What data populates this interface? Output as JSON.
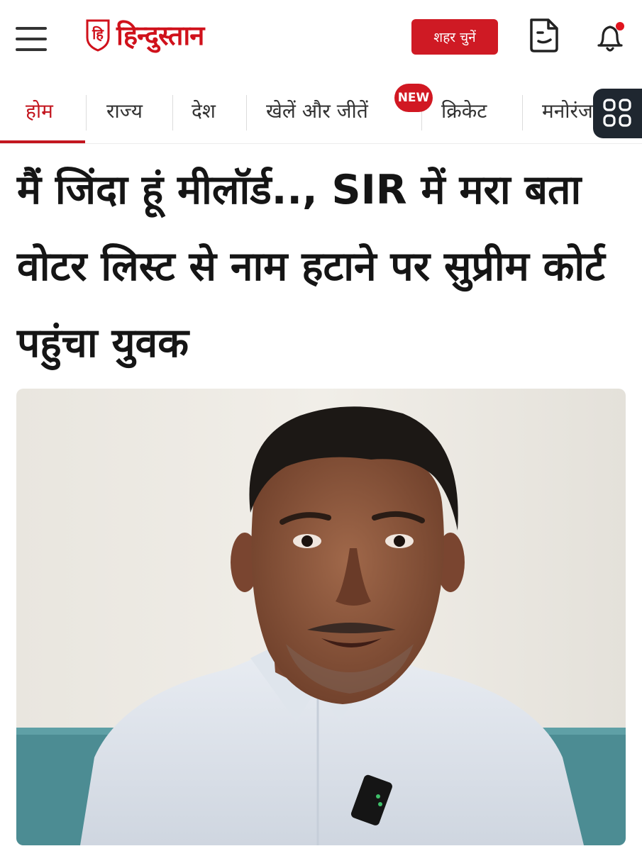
{
  "header": {
    "logo_mark": "हि",
    "logo_text": "हिन्दुस्तान",
    "city_button": "शहर चुनें",
    "accent_color": "#cf1a24",
    "icons": [
      "hamburger-menu-icon",
      "epaper-icon",
      "bell-icon",
      "apps-grid-icon"
    ]
  },
  "nav": {
    "items": [
      {
        "label": "होम",
        "active": true
      },
      {
        "label": "राज्य"
      },
      {
        "label": "देश"
      },
      {
        "label": "खेलें और जीतें"
      },
      {
        "label": "क्रिकेट"
      },
      {
        "label": "मनोरंजन"
      }
    ],
    "badge": "NEW"
  },
  "article": {
    "headline": "मैं जिंदा हूं मीलॉर्ड.., SIR में मरा बता वोटर लिस्ट से नाम हटाने पर सुप्रीम कोर्ट पहुंचा युवक"
  }
}
